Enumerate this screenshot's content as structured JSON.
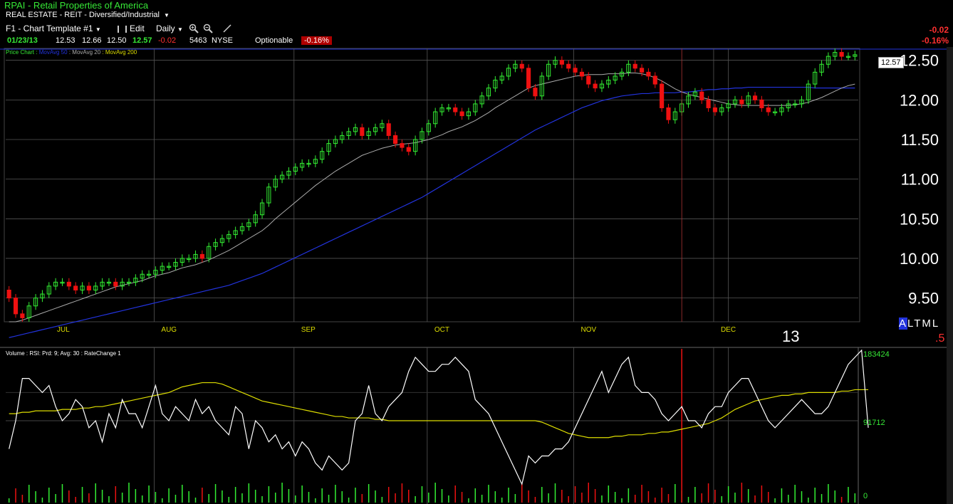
{
  "header": {
    "symbol_title": "RPAI - Retail Properties of America",
    "sector": "REAL ESTATE - REIT - Diversified/Industrial"
  },
  "toolbar": {
    "template": "F1 - Chart Template #1",
    "edit_label": "Edit",
    "period": "Daily"
  },
  "quote": {
    "date": "01/23/13",
    "open": "12.53",
    "high": "12.66",
    "low": "12.50",
    "last": "12.57",
    "change": "-0.02",
    "volume": "5463",
    "exchange": "NYSE",
    "optionable": "Optionable",
    "pct_change": "-0.16%",
    "right_change": "-0.02",
    "right_pct": "-0.16%"
  },
  "price_panel": {
    "legend": {
      "price_chart": "Price Chart :",
      "ma50": "MovAvg 50",
      "ma20": "MovAvg 20",
      "ma200": "MovAvg 200"
    },
    "last_label": "12.57",
    "year_label": "13",
    "scale_labels": [
      "A",
      "L",
      "T",
      "M",
      "L"
    ],
    "fraction_label": ".5"
  },
  "volume_panel": {
    "legend": "Volume : RSI: Prd: 9; Avg: 30 : RateChange 1",
    "scale": [
      "183424",
      "91712",
      "0"
    ]
  },
  "colors": {
    "up": "#33ee33",
    "down": "#ee1111",
    "ma_blue": "#2233dd",
    "ma_gray": "#aaaaaa",
    "ma_yellow": "#dddd00",
    "grid": "#555555"
  },
  "chart_data": {
    "type": "candlestick",
    "price_axis": {
      "min": 9.2,
      "max": 12.65,
      "ticks": [
        "12.50",
        "12.00",
        "11.50",
        "11.00",
        "10.50",
        "10.00",
        "9.50"
      ]
    },
    "months": [
      "JUL",
      "AUG",
      "SEP",
      "OCT",
      "NOV",
      "DEC"
    ],
    "close": [
      9.5,
      9.3,
      9.25,
      9.4,
      9.5,
      9.55,
      9.65,
      9.7,
      9.7,
      9.65,
      9.6,
      9.65,
      9.6,
      9.65,
      9.7,
      9.7,
      9.65,
      9.7,
      9.7,
      9.75,
      9.8,
      9.8,
      9.85,
      9.9,
      9.9,
      9.95,
      10.0,
      10.0,
      10.05,
      10.0,
      10.15,
      10.2,
      10.25,
      10.3,
      10.35,
      10.4,
      10.45,
      10.55,
      10.7,
      10.9,
      11.0,
      11.05,
      11.1,
      11.15,
      11.2,
      11.2,
      11.25,
      11.35,
      11.45,
      11.5,
      11.55,
      11.6,
      11.65,
      11.55,
      11.6,
      11.65,
      11.7,
      11.55,
      11.45,
      11.4,
      11.35,
      11.5,
      11.6,
      11.7,
      11.85,
      11.9,
      11.9,
      11.85,
      11.8,
      11.85,
      11.95,
      12.05,
      12.15,
      12.25,
      12.3,
      12.4,
      12.45,
      12.4,
      12.15,
      12.05,
      12.3,
      12.45,
      12.5,
      12.45,
      12.4,
      12.35,
      12.3,
      12.2,
      12.15,
      12.2,
      12.25,
      12.3,
      12.35,
      12.45,
      12.4,
      12.35,
      12.3,
      12.2,
      11.9,
      11.75,
      11.85,
      11.95,
      12.05,
      12.1,
      12.0,
      11.9,
      11.85,
      11.9,
      11.95,
      12.0,
      11.95,
      12.05,
      12.0,
      11.9,
      11.85,
      11.85,
      11.9,
      11.95,
      11.95,
      12.0,
      12.2,
      12.35,
      12.45,
      12.55,
      12.6,
      12.55,
      12.55,
      12.57
    ],
    "ma20": [
      9.2,
      9.2,
      9.22,
      9.25,
      9.28,
      9.31,
      9.34,
      9.37,
      9.4,
      9.43,
      9.46,
      9.49,
      9.52,
      9.55,
      9.58,
      9.61,
      9.64,
      9.66,
      9.68,
      9.7,
      9.72,
      9.75,
      9.78,
      9.8,
      9.82,
      9.85,
      9.88,
      9.9,
      9.92,
      9.95,
      9.98,
      10.02,
      10.06,
      10.1,
      10.15,
      10.2,
      10.25,
      10.3,
      10.35,
      10.42,
      10.5,
      10.57,
      10.64,
      10.71,
      10.78,
      10.85,
      10.92,
      10.98,
      11.04,
      11.1,
      11.15,
      11.2,
      11.25,
      11.3,
      11.33,
      11.36,
      11.39,
      11.41,
      11.43,
      11.44,
      11.45,
      11.46,
      11.48,
      11.5,
      11.53,
      11.56,
      11.6,
      11.63,
      11.66,
      11.7,
      11.74,
      11.79,
      11.84,
      11.9,
      11.95,
      12.0,
      12.05,
      12.1,
      12.15,
      12.18,
      12.2,
      12.22,
      12.24,
      12.26,
      12.28,
      12.3,
      12.31,
      12.32,
      12.32,
      12.32,
      12.33,
      12.33,
      12.33,
      12.34,
      12.34,
      12.33,
      12.31,
      12.28,
      12.24,
      12.19,
      12.14,
      12.1,
      12.07,
      12.05,
      12.03,
      12.01,
      11.99,
      11.97,
      11.95,
      11.94,
      11.93,
      11.93,
      11.93,
      11.93,
      11.93,
      11.93,
      11.93,
      11.93,
      11.94,
      11.95,
      11.97,
      12.0,
      12.03,
      12.07,
      12.11,
      12.15,
      12.18,
      12.2
    ],
    "ma50": [
      9.0,
      9.02,
      9.04,
      9.06,
      9.08,
      9.1,
      9.12,
      9.14,
      9.16,
      9.18,
      9.2,
      9.22,
      9.24,
      9.26,
      9.28,
      9.3,
      9.32,
      9.34,
      9.36,
      9.38,
      9.4,
      9.42,
      9.44,
      9.46,
      9.48,
      9.5,
      9.52,
      9.54,
      9.56,
      9.58,
      9.6,
      9.62,
      9.64,
      9.66,
      9.69,
      9.72,
      9.75,
      9.78,
      9.81,
      9.85,
      9.89,
      9.93,
      9.97,
      10.01,
      10.05,
      10.09,
      10.13,
      10.17,
      10.21,
      10.25,
      10.29,
      10.33,
      10.37,
      10.41,
      10.45,
      10.49,
      10.53,
      10.57,
      10.61,
      10.65,
      10.69,
      10.73,
      10.77,
      10.82,
      10.87,
      10.92,
      10.97,
      11.02,
      11.07,
      11.12,
      11.17,
      11.22,
      11.27,
      11.32,
      11.37,
      11.42,
      11.47,
      11.52,
      11.57,
      11.62,
      11.66,
      11.7,
      11.74,
      11.78,
      11.82,
      11.86,
      11.9,
      11.93,
      11.96,
      11.99,
      12.01,
      12.03,
      12.05,
      12.06,
      12.07,
      12.08,
      12.08,
      12.09,
      12.09,
      12.09,
      12.09,
      12.1,
      12.1,
      12.11,
      12.12,
      12.13,
      12.13,
      12.14,
      12.14,
      12.15,
      12.15,
      12.16,
      12.16,
      12.16,
      12.16,
      12.16,
      12.16,
      12.16,
      12.16,
      12.16,
      12.16,
      12.15,
      12.15,
      12.15,
      12.15,
      12.15,
      12.15,
      12.15
    ],
    "rsi": [
      0.3,
      0.5,
      0.8,
      0.8,
      0.75,
      0.7,
      0.75,
      0.6,
      0.5,
      0.55,
      0.65,
      0.6,
      0.45,
      0.5,
      0.35,
      0.55,
      0.45,
      0.65,
      0.55,
      0.55,
      0.45,
      0.6,
      0.75,
      0.55,
      0.5,
      0.6,
      0.55,
      0.5,
      0.65,
      0.55,
      0.6,
      0.5,
      0.45,
      0.4,
      0.6,
      0.55,
      0.3,
      0.5,
      0.45,
      0.35,
      0.4,
      0.3,
      0.35,
      0.25,
      0.35,
      0.3,
      0.2,
      0.15,
      0.25,
      0.2,
      0.15,
      0.2,
      0.5,
      0.55,
      0.75,
      0.55,
      0.5,
      0.6,
      0.65,
      0.7,
      0.85,
      0.95,
      0.9,
      0.85,
      0.85,
      0.9,
      0.9,
      0.95,
      0.9,
      0.85,
      0.65,
      0.6,
      0.55,
      0.45,
      0.35,
      0.25,
      0.15,
      0.05,
      0.25,
      0.2,
      0.25,
      0.25,
      0.3,
      0.3,
      0.35,
      0.45,
      0.55,
      0.65,
      0.75,
      0.85,
      0.7,
      0.8,
      0.9,
      0.95,
      0.75,
      0.7,
      0.7,
      0.65,
      0.55,
      0.5,
      0.55,
      0.6,
      0.5,
      0.5,
      0.45,
      0.55,
      0.6,
      0.6,
      0.7,
      0.75,
      0.8,
      0.8,
      0.7,
      0.6,
      0.5,
      0.45,
      0.5,
      0.55,
      0.6,
      0.65,
      0.6,
      0.55,
      0.55,
      0.6,
      0.7,
      0.8,
      0.9,
      0.95,
      1.0,
      0.45
    ],
    "rsi_avg": [
      0.55,
      0.55,
      0.56,
      0.56,
      0.57,
      0.57,
      0.57,
      0.57,
      0.58,
      0.58,
      0.58,
      0.59,
      0.59,
      0.6,
      0.6,
      0.61,
      0.62,
      0.63,
      0.64,
      0.65,
      0.66,
      0.67,
      0.68,
      0.69,
      0.7,
      0.72,
      0.74,
      0.75,
      0.76,
      0.77,
      0.77,
      0.77,
      0.76,
      0.74,
      0.72,
      0.7,
      0.68,
      0.66,
      0.64,
      0.63,
      0.62,
      0.61,
      0.6,
      0.59,
      0.58,
      0.57,
      0.56,
      0.55,
      0.54,
      0.53,
      0.53,
      0.52,
      0.52,
      0.52,
      0.52,
      0.51,
      0.51,
      0.5,
      0.5,
      0.5,
      0.5,
      0.5,
      0.5,
      0.5,
      0.5,
      0.5,
      0.5,
      0.5,
      0.5,
      0.5,
      0.5,
      0.5,
      0.5,
      0.5,
      0.5,
      0.5,
      0.5,
      0.5,
      0.5,
      0.5,
      0.49,
      0.47,
      0.45,
      0.43,
      0.41,
      0.4,
      0.39,
      0.38,
      0.38,
      0.38,
      0.38,
      0.39,
      0.39,
      0.4,
      0.4,
      0.4,
      0.41,
      0.41,
      0.42,
      0.42,
      0.43,
      0.44,
      0.45,
      0.46,
      0.47,
      0.48,
      0.5,
      0.52,
      0.55,
      0.58,
      0.6,
      0.62,
      0.64,
      0.65,
      0.66,
      0.67,
      0.68,
      0.68,
      0.69,
      0.69,
      0.7,
      0.7,
      0.7,
      0.7,
      0.7,
      0.71,
      0.71,
      0.72,
      0.72,
      0.72
    ],
    "month_start_index": [
      0,
      22,
      43,
      63,
      85,
      106
    ],
    "vol_spike_index": 101
  }
}
